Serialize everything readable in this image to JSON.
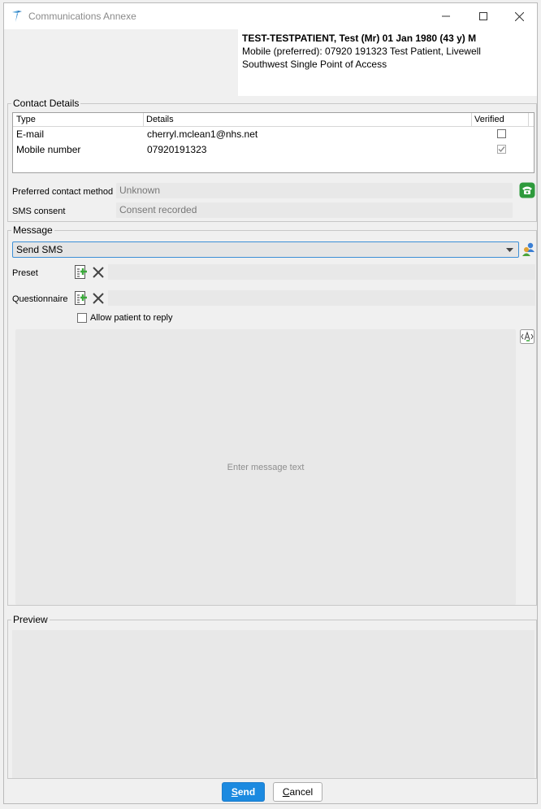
{
  "window": {
    "title": "Communications Annexe"
  },
  "patient": {
    "name_line": "TEST-TESTPATIENT, Test (Mr) 01 Jan 1980 (43 y) M",
    "line2": "Mobile (preferred): 07920 191323   Test Patient, Livewell",
    "line3": "Southwest Single Point of Access"
  },
  "contact_details": {
    "legend": "Contact Details",
    "columns": [
      "Type",
      "Details",
      "Verified"
    ],
    "rows": [
      {
        "type": "E-mail",
        "details": "cherryl.mclean1@nhs.net",
        "verified": false
      },
      {
        "type": "Mobile number",
        "details": "07920191323",
        "verified": true
      }
    ],
    "preferred_label": "Preferred contact method",
    "preferred_value": "Unknown",
    "sms_label": "SMS consent",
    "sms_value": "Consent recorded"
  },
  "message": {
    "legend": "Message",
    "type_selected": "Send SMS",
    "preset_label": "Preset",
    "questionnaire_label": "Questionnaire",
    "allow_reply_label": "Allow patient to reply",
    "allow_reply_checked": false,
    "text_placeholder": "Enter message text"
  },
  "preview": {
    "legend": "Preview"
  },
  "buttons": {
    "send_mnemonic": "S",
    "send_rest": "end",
    "cancel_mnemonic": "C",
    "cancel_rest": "ancel"
  },
  "colors": {
    "accent": "#1c8ae0",
    "field_bg": "#e8e8e8",
    "phone_icon": "#2e9a3c"
  },
  "icons": [
    "app-logo-icon",
    "minimize-icon",
    "maximize-icon",
    "close-icon",
    "phone-icon",
    "people-icon",
    "add-template-icon",
    "clear-icon",
    "text-format-icon",
    "chevron-down-icon"
  ]
}
